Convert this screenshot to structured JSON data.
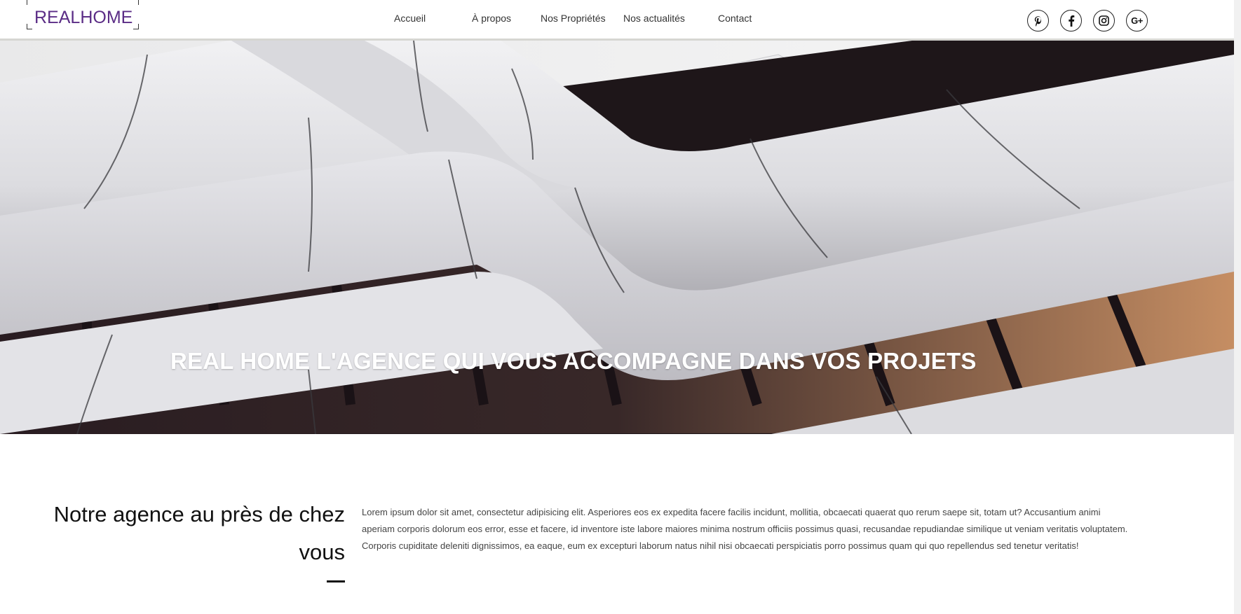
{
  "header": {
    "logo": {
      "light": "REAL",
      "bold": "HOME"
    },
    "nav": [
      {
        "label": "Accueil"
      },
      {
        "label": "À propos"
      },
      {
        "label": "Nos Propriétés"
      },
      {
        "label": "Nos actualités"
      },
      {
        "label": "Contact"
      }
    ],
    "social": [
      {
        "icon": "pinterest-icon"
      },
      {
        "icon": "facebook-icon"
      },
      {
        "icon": "instagram-icon"
      },
      {
        "icon": "google-plus-icon",
        "label": "G+"
      }
    ]
  },
  "hero": {
    "title": "REAL HOME L'AGENCE QUI VOUS ACCOMPAGNE DANS VOS PROJETS",
    "image": "modern-building-facade"
  },
  "intro": {
    "title": "Notre agence au près de chez vous",
    "text": "Lorem ipsum dolor sit amet, consectetur adipisicing elit. Asperiores eos ex expedita facere facilis incidunt, mollitia, obcaecati quaerat quo rerum saepe sit, totam ut? Accusantium animi aperiam corporis dolorum eos error, esse et facere, id inventore iste labore maiores minima nostrum officiis possimus quasi, recusandae repudiandae similique ut veniam veritatis voluptatem. Corporis cupiditate deleniti dignissimos, ea eaque, eum ex excepturi laborum natus nihil nisi obcaecati perspiciatis porro possimus quam qui quo repellendus sed tenetur veritatis!"
  },
  "colors": {
    "brand": "#5b2d86",
    "text": "#222222",
    "hero_title": "#ffffff",
    "header_border": "#d6d6d2"
  }
}
